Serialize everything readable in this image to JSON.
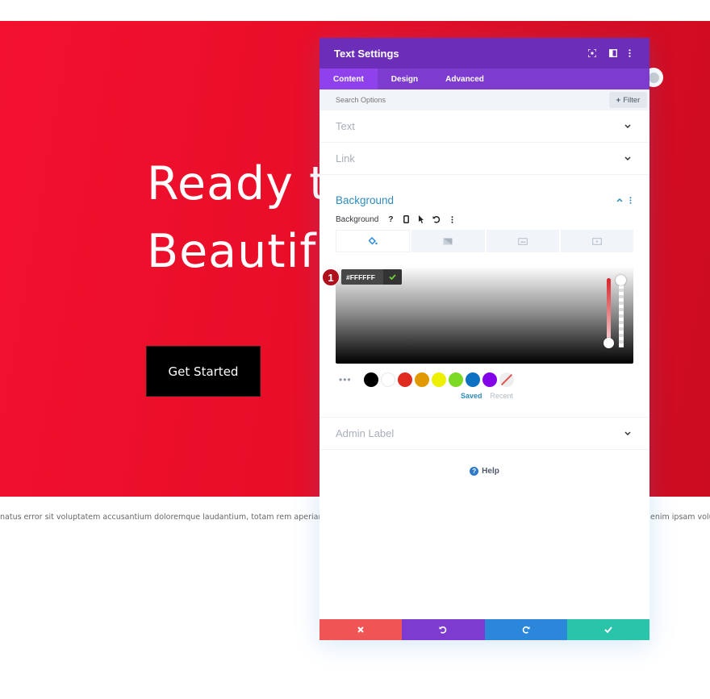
{
  "hero": {
    "title_line1": "Ready t",
    "title_line2": "Beautif",
    "cta_label": "Get Started",
    "body_text_left": "natus error sit voluptatem accusantium doloremque laudantium, totam rem aperiam, eaque",
    "body_text_right": "enim ipsam volup"
  },
  "panel": {
    "title": "Text Settings",
    "header_icons": [
      "focus-icon",
      "split-view-icon",
      "more-vertical-icon"
    ],
    "tabs": [
      {
        "label": "Content",
        "active": true
      },
      {
        "label": "Design",
        "active": false
      },
      {
        "label": "Advanced",
        "active": false
      }
    ],
    "search": {
      "placeholder": "Search Options",
      "filter_label": "Filter"
    },
    "sections": {
      "text": "Text",
      "link": "Link",
      "background": "Background",
      "admin_label": "Admin Label"
    },
    "background": {
      "option_label": "Background",
      "option_icons": [
        "help-icon",
        "mobile-icon",
        "cursor-icon",
        "reset-icon",
        "more-icon"
      ],
      "type_tabs": [
        "color-icon",
        "gradient-icon",
        "image-icon",
        "video-icon"
      ],
      "color_picker": {
        "hex_value": "#FFFFFF",
        "badge_number": "1"
      },
      "swatches": [
        "#000000",
        "#ffffff",
        "#e02b20",
        "#e09900",
        "#edf000",
        "#7cda24",
        "#0c71c3",
        "#8300e9"
      ],
      "swatch_more": "•••",
      "saved_label": "Saved",
      "recent_label": "Recent"
    },
    "help_label": "Help",
    "footer": {
      "close": "close-icon",
      "undo": "undo-icon",
      "redo": "redo-icon",
      "save": "check-icon"
    },
    "colors": {
      "header": "#6c2eb9",
      "tabs": "#7e3bd0",
      "close": "#ef5555",
      "undo": "#7e3bd0",
      "redo": "#2b87da",
      "save": "#29c4a9",
      "accent": "#2e8bbd"
    }
  }
}
